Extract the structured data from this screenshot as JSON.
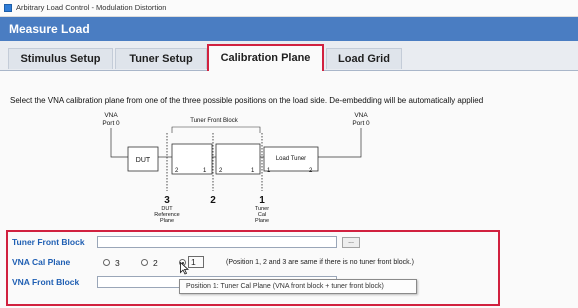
{
  "window": {
    "title": "Arbitrary Load Control - Modulation Distortion"
  },
  "header": {
    "title": "Measure Load"
  },
  "tabs": [
    {
      "label": "Stimulus Setup",
      "active": false
    },
    {
      "label": "Tuner Setup",
      "active": false
    },
    {
      "label": "Calibration Plane",
      "active": true
    },
    {
      "label": "Load Grid",
      "active": false
    }
  ],
  "instruction": "Select the VNA calibration plane from one of the three possible positions on the load side. De-embedding will be automatically applied",
  "diagram": {
    "vna_left": {
      "line1": "VNA",
      "line2": "Port 0"
    },
    "vna_right": {
      "line1": "VNA",
      "line2": "Port 0"
    },
    "tuner_front_block": "Tuner Front Block",
    "dut": "DUT",
    "load_tuner": "Load Tuner",
    "port_nums": [
      "2",
      "1",
      "2",
      "1",
      "1",
      "2"
    ],
    "planes": [
      {
        "number": "3",
        "label_lines": [
          "DUT",
          "Reference",
          "Plane"
        ]
      },
      {
        "number": "2",
        "label_lines": []
      },
      {
        "number": "1",
        "label_lines": [
          "Tuner",
          "Cal",
          "Plane"
        ]
      }
    ]
  },
  "form": {
    "tuner_front_block_label": "Tuner Front Block",
    "tuner_front_block_value": "",
    "browse_label": "...",
    "vna_cal_plane_label": "VNA Cal Plane",
    "radio_options": [
      "3",
      "2",
      "1"
    ],
    "selected_option": "1",
    "position_note": "(Position 1, 2 and 3 are same if there is no tuner front block.)",
    "vna_front_block_label": "VNA Front Block",
    "vna_front_block_value": "",
    "tooltip": "Position 1: Tuner Cal Plane (VNA front block + tuner front block)"
  },
  "colors": {
    "header_bg": "#4a7dc2",
    "highlight": "#d1213f",
    "label_blue": "#1f5fb3"
  }
}
